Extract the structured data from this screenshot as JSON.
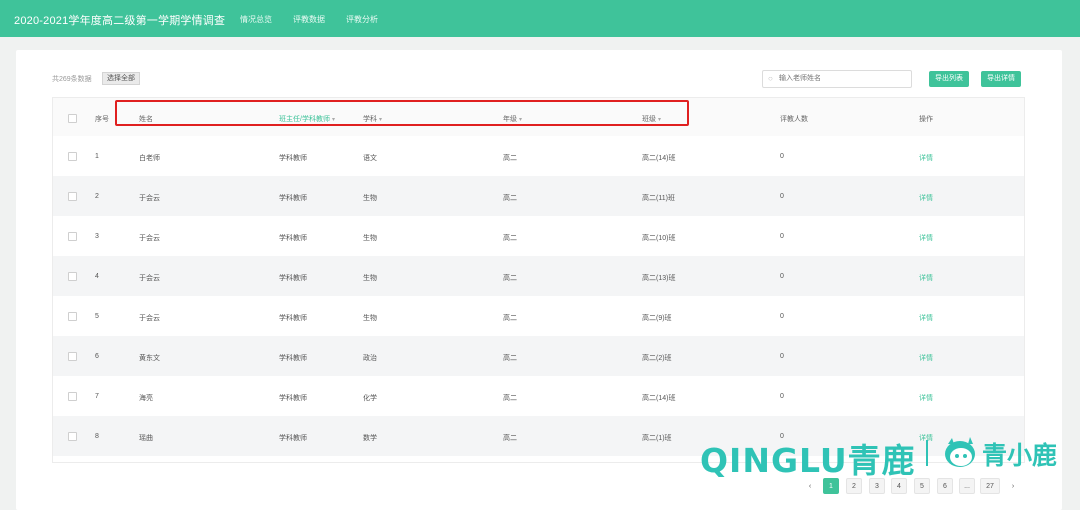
{
  "header": {
    "title": "2020-2021学年度高二级第一学期学情调查",
    "nav": [
      "情况总览",
      "评教数据",
      "评教分析"
    ]
  },
  "toolbar": {
    "count_text": "共269条数据",
    "select_all": "选择全部",
    "search_placeholder": "输入老师姓名",
    "export_list": "导出列表",
    "export_detail": "导出详情"
  },
  "table": {
    "headers": {
      "index": "序号",
      "name": "姓名",
      "role": "班主任/学科教师",
      "subject": "学科",
      "grade": "年级",
      "class": "班级",
      "raters": "评教人数",
      "action": "操作"
    },
    "rows": [
      {
        "index": "1",
        "name": "白老师",
        "role": "学科教师",
        "subject": "语文",
        "grade": "高二",
        "class": "高二(14)班",
        "raters": "0",
        "action": "详情"
      },
      {
        "index": "2",
        "name": "于会云",
        "role": "学科教师",
        "subject": "生物",
        "grade": "高二",
        "class": "高二(11)班",
        "raters": "0",
        "action": "详情"
      },
      {
        "index": "3",
        "name": "于会云",
        "role": "学科教师",
        "subject": "生物",
        "grade": "高二",
        "class": "高二(10)班",
        "raters": "0",
        "action": "详情"
      },
      {
        "index": "4",
        "name": "于会云",
        "role": "学科教师",
        "subject": "生物",
        "grade": "高二",
        "class": "高二(13)班",
        "raters": "0",
        "action": "详情"
      },
      {
        "index": "5",
        "name": "于会云",
        "role": "学科教师",
        "subject": "生物",
        "grade": "高二",
        "class": "高二(9)班",
        "raters": "0",
        "action": "详情"
      },
      {
        "index": "6",
        "name": "黄东文",
        "role": "学科教师",
        "subject": "政治",
        "grade": "高二",
        "class": "高二(2)班",
        "raters": "0",
        "action": "详情"
      },
      {
        "index": "7",
        "name": "海亮",
        "role": "学科教师",
        "subject": "化学",
        "grade": "高二",
        "class": "高二(14)班",
        "raters": "0",
        "action": "详情"
      },
      {
        "index": "8",
        "name": "瑶曲",
        "role": "学科教师",
        "subject": "数学",
        "grade": "高二",
        "class": "高二(1)班",
        "raters": "0",
        "action": "详情"
      }
    ]
  },
  "pagination": {
    "prev": "‹",
    "pages": [
      "1",
      "2",
      "3",
      "4",
      "5",
      "6",
      "...",
      "27"
    ],
    "next": "›",
    "current": "1"
  },
  "watermark": {
    "brand": "QINGLU青鹿",
    "sub": "青小鹿"
  },
  "colors": {
    "accent": "#3fc39a",
    "highlight": "#e02020",
    "watermark": "#2fc3b6"
  },
  "icons": {
    "search": "search-icon",
    "sort": "caret-down-icon"
  }
}
